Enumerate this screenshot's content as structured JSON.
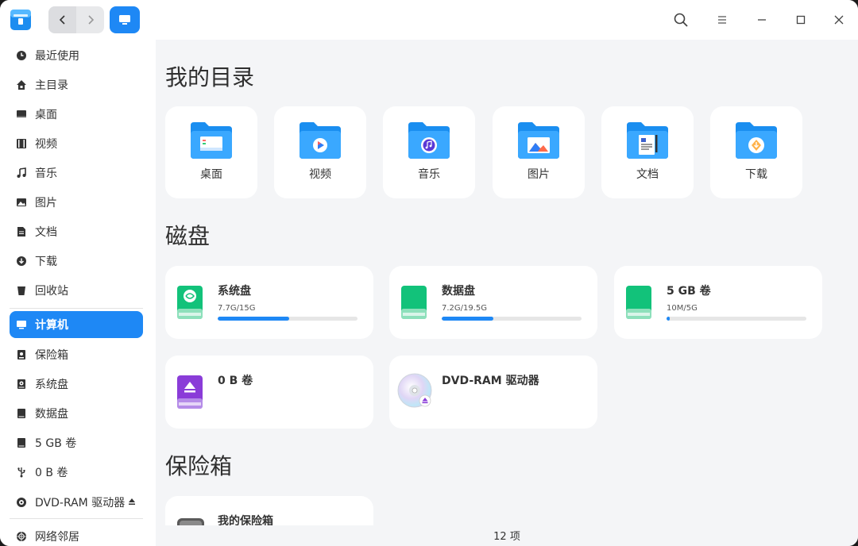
{
  "titlebar": {
    "nav_back": "back",
    "nav_forward": "forward",
    "icons": [
      "search-icon",
      "menu-icon",
      "minimize-icon",
      "maximize-icon",
      "close-icon"
    ]
  },
  "sidebar": {
    "items": [
      {
        "label": "最近使用",
        "icon": "clock-icon"
      },
      {
        "label": "主目录",
        "icon": "home-icon"
      },
      {
        "label": "桌面",
        "icon": "desktop-icon"
      },
      {
        "label": "视频",
        "icon": "video-icon"
      },
      {
        "label": "音乐",
        "icon": "music-icon"
      },
      {
        "label": "图片",
        "icon": "picture-icon"
      },
      {
        "label": "文档",
        "icon": "document-icon"
      },
      {
        "label": "下载",
        "icon": "download-icon"
      },
      {
        "label": "回收站",
        "icon": "trash-icon"
      },
      {
        "label": "计算机",
        "icon": "computer-icon",
        "active": true
      },
      {
        "label": "保险箱",
        "icon": "vault-icon"
      },
      {
        "label": "系统盘",
        "icon": "disk-icon"
      },
      {
        "label": "数据盘",
        "icon": "disk-icon"
      },
      {
        "label": "5 GB 卷",
        "icon": "disk-icon"
      },
      {
        "label": "0 B 卷",
        "icon": "usb-icon"
      },
      {
        "label": "DVD-RAM 驱动器",
        "icon": "optical-icon"
      },
      {
        "label": "网络邻居",
        "icon": "network-icon"
      }
    ]
  },
  "main": {
    "section_dirs": "我的目录",
    "section_disks": "磁盘",
    "section_vault": "保险箱",
    "dirs": [
      "桌面",
      "视频",
      "音乐",
      "图片",
      "文档",
      "下载"
    ],
    "disks": [
      {
        "name": "系统盘",
        "size": "7.7G/15G",
        "usage": 0.51
      },
      {
        "name": "数据盘",
        "size": "7.2G/19.5G",
        "usage": 0.37
      },
      {
        "name": "5 GB 卷",
        "size": "10M/5G",
        "usage": 0.02
      },
      {
        "name": "0 B 卷"
      },
      {
        "name": "DVD-RAM 驱动器"
      }
    ],
    "vault": {
      "name": "我的保险箱"
    }
  },
  "status": {
    "count": "12 项"
  },
  "colors": {
    "accent": "#1e88f5",
    "folder": "#1a9af0"
  }
}
